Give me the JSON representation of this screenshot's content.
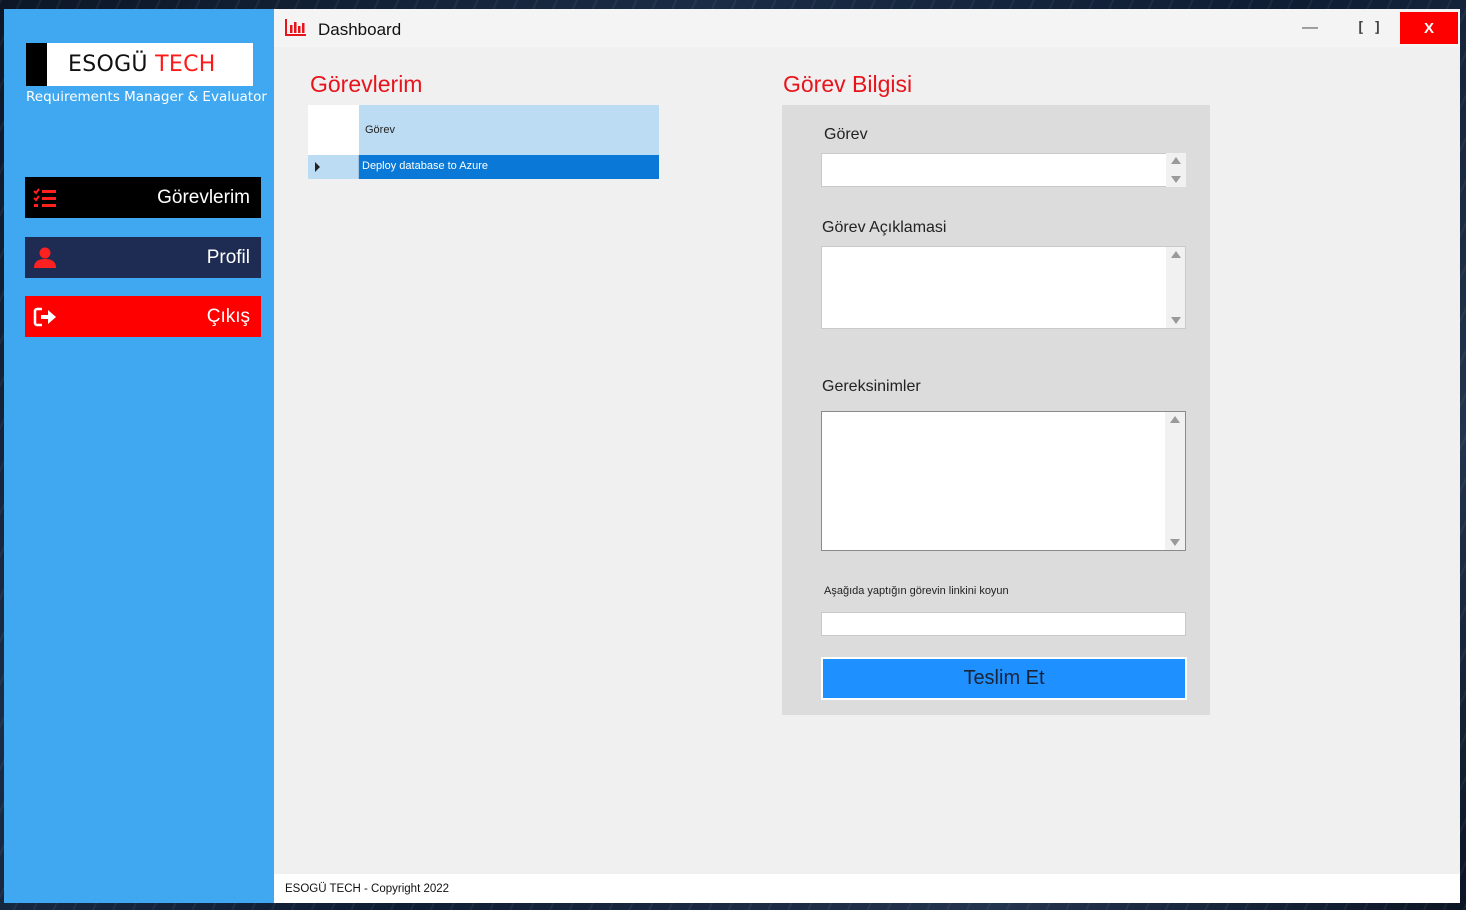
{
  "app": {
    "logo_main": "ESOGÜ",
    "logo_accent": "TECH",
    "tagline": "Requirements Manager & Evaluator"
  },
  "sidebar": {
    "items": [
      {
        "label": "Görevlerim",
        "icon": "tasks-list-icon"
      },
      {
        "label": "Profil",
        "icon": "user-icon"
      },
      {
        "label": "Çıkış",
        "icon": "sign-out-icon"
      }
    ]
  },
  "window": {
    "title": "Dashboard",
    "icon": "chart-icon",
    "controls": {
      "minimize": "—",
      "maximize": "[ ]",
      "close": "X"
    }
  },
  "tasks": {
    "title": "Görevlerim",
    "columns": [
      "Görev"
    ],
    "rows": [
      {
        "task": "Deploy database to Azure",
        "selected": true
      }
    ]
  },
  "task_info": {
    "title": "Görev Bilgisi",
    "task_label": "Görev",
    "task_value": "",
    "description_label": "Görev Açıklamasi",
    "description_value": "",
    "requirements_label": "Gereksinimler",
    "requirements_value": "",
    "link_label": "Aşağıda yaptığın görevin linkini koyun",
    "link_value": "",
    "submit_label": "Teslim Et"
  },
  "footer": {
    "text": "ESOGÜ TECH - Copyright 2022"
  },
  "colors": {
    "sidebar_bg": "#3fa8f0",
    "accent_red": "#e8141c",
    "nav_tasks_bg": "#000000",
    "nav_profile_bg": "#1e2b52",
    "nav_logout_bg": "#ff0000",
    "selection_blue": "#0a78d7",
    "submit_blue": "#1e90ff"
  }
}
